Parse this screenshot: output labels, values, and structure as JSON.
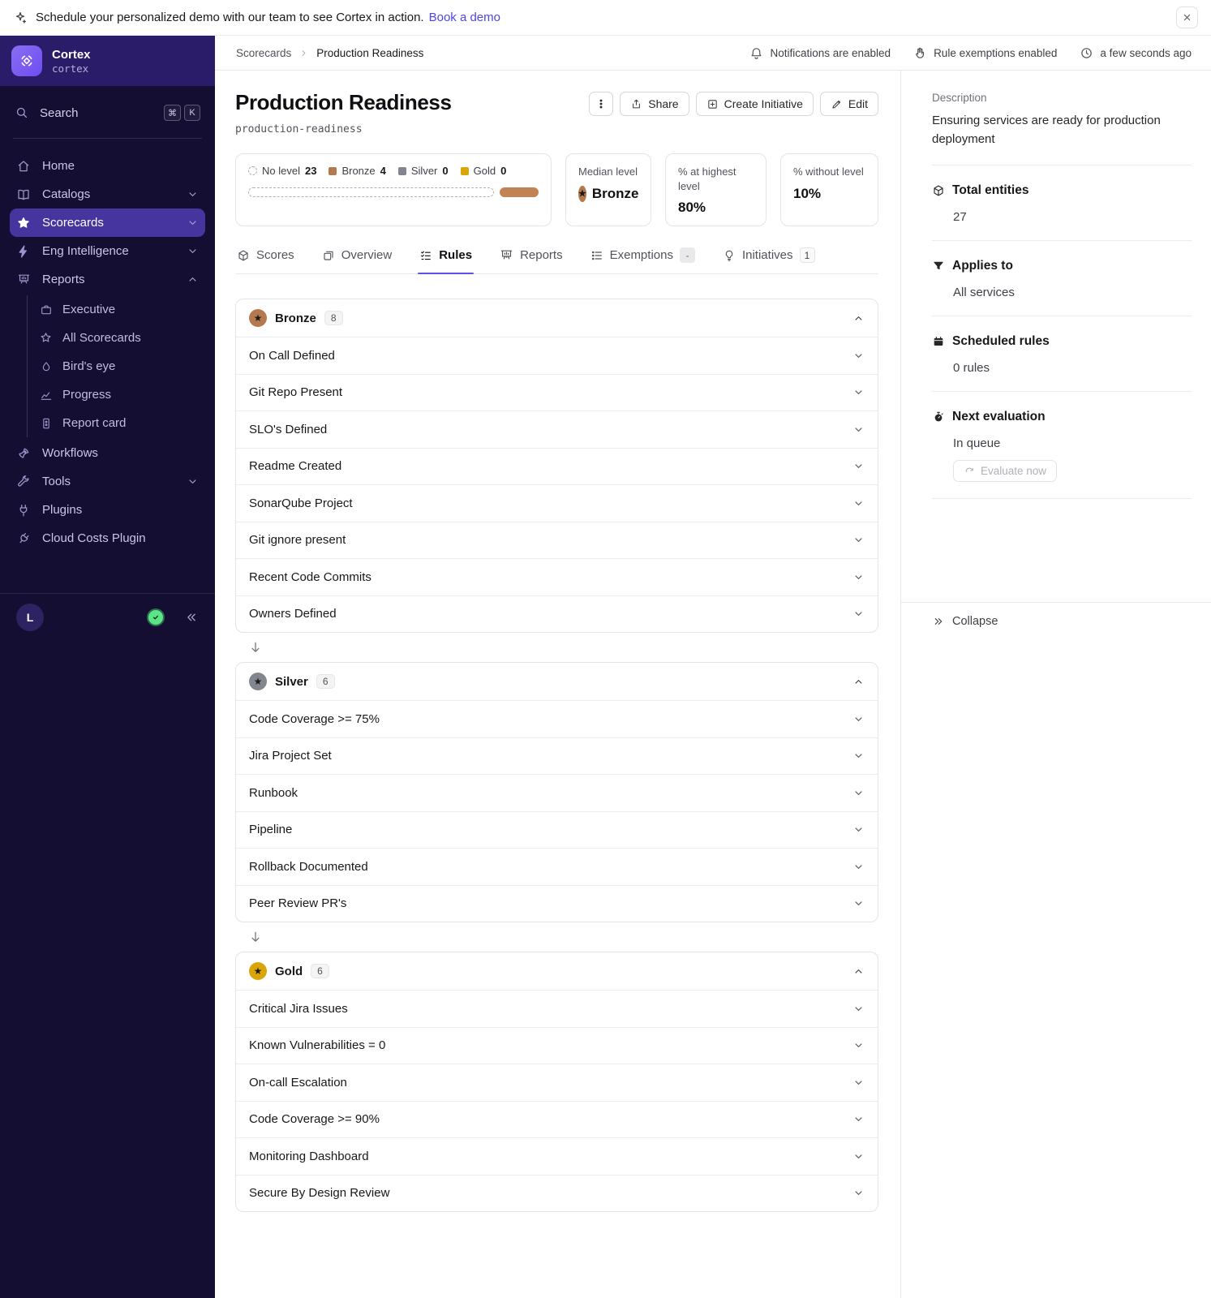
{
  "banner": {
    "text": "Schedule your personalized demo with our team to see Cortex in action.",
    "link": "Book a demo"
  },
  "sidebar": {
    "logo_title": "Cortex",
    "logo_subtitle": "cortex",
    "search": {
      "label": "Search",
      "keys": [
        "⌘",
        "K"
      ]
    },
    "items": [
      {
        "label": "Home",
        "icon": "home"
      },
      {
        "label": "Catalogs",
        "icon": "book",
        "chevron": "down"
      },
      {
        "label": "Scorecards",
        "icon": "star",
        "chevron": "down",
        "active": true
      },
      {
        "label": "Eng Intelligence",
        "icon": "lightning",
        "chevron": "down"
      },
      {
        "label": "Reports",
        "icon": "presentation",
        "chevron": "up",
        "children": [
          {
            "label": "Executive",
            "icon": "briefcase"
          },
          {
            "label": "All Scorecards",
            "icon": "star-outline"
          },
          {
            "label": "Bird's eye",
            "icon": "bird"
          },
          {
            "label": "Progress",
            "icon": "chart-line"
          },
          {
            "label": "Report card",
            "icon": "report-card"
          }
        ]
      },
      {
        "label": "Workflows",
        "icon": "rocket"
      },
      {
        "label": "Tools",
        "icon": "wrench",
        "chevron": "down"
      },
      {
        "label": "Plugins",
        "icon": "plug"
      },
      {
        "label": "Cloud Costs Plugin",
        "icon": "plug-outline"
      }
    ],
    "user_initial": "L"
  },
  "topbar": {
    "breadcrumb": [
      "Scorecards",
      "Production Readiness"
    ],
    "status": [
      {
        "label": "Notifications are enabled",
        "icon": "bell"
      },
      {
        "label": "Rule exemptions enabled",
        "icon": "hand"
      },
      {
        "label": "a few seconds ago",
        "icon": "clock"
      }
    ]
  },
  "header": {
    "title": "Production Readiness",
    "slug": "production-readiness",
    "buttons": {
      "share": "Share",
      "create_initiative": "Create Initiative",
      "edit": "Edit"
    }
  },
  "stats": {
    "levels": [
      {
        "label": "No level",
        "count": "23",
        "swatch": "dashed",
        "color": ""
      },
      {
        "label": "Bronze",
        "count": "4",
        "swatch": "solid",
        "color": "#b5794f"
      },
      {
        "label": "Silver",
        "count": "0",
        "swatch": "solid",
        "color": "#81868f"
      },
      {
        "label": "Gold",
        "count": "0",
        "swatch": "solid",
        "color": "#d9a509"
      }
    ],
    "bar": {
      "no_level_pct": 84.5,
      "bronze_pct": 13.5,
      "bronze_color": "#c18353"
    },
    "median": {
      "label": "Median level",
      "value": "Bronze",
      "medal_color": "#b5794f"
    },
    "highest": {
      "label": "% at highest level",
      "value": "80%"
    },
    "without": {
      "label": "% without level",
      "value": "10%"
    }
  },
  "tabs": [
    {
      "label": "Scores",
      "icon": "cube"
    },
    {
      "label": "Overview",
      "icon": "overview"
    },
    {
      "label": "Rules",
      "icon": "checklist",
      "active": true
    },
    {
      "label": "Reports",
      "icon": "presentation",
      "badge": ""
    },
    {
      "label": "Exemptions",
      "icon": "list",
      "badge": "-"
    },
    {
      "label": "Initiatives",
      "icon": "lightbulb",
      "badge": "1",
      "badge_style": "outlined"
    }
  ],
  "rule_groups": [
    {
      "name": "Bronze",
      "count": "8",
      "color": "#b5794f",
      "rules": [
        "On Call Defined",
        "Git Repo Present",
        "SLO's Defined",
        "Readme Created",
        "SonarQube Project",
        "Git ignore present",
        "Recent Code Commits",
        "Owners Defined"
      ]
    },
    {
      "name": "Silver",
      "count": "6",
      "color": "#81868f",
      "rules": [
        "Code Coverage >= 75%",
        "Jira Project Set",
        "Runbook",
        "Pipeline",
        "Rollback Documented",
        "Peer Review PR's"
      ]
    },
    {
      "name": "Gold",
      "count": "6",
      "color": "#d9a509",
      "rules": [
        "Critical Jira Issues",
        "Known Vulnerabilities = 0",
        "On-call Escalation",
        "Code Coverage >= 90%",
        "Monitoring Dashboard",
        "Secure By Design Review"
      ]
    }
  ],
  "details": {
    "description_label": "Description",
    "description": "Ensuring services are ready for production deployment",
    "sections": [
      {
        "icon": "cube",
        "title": "Total entities",
        "value": "27"
      },
      {
        "icon": "funnel",
        "title": "Applies to",
        "value": "All services"
      },
      {
        "icon": "calendar",
        "title": "Scheduled rules",
        "value": "0 rules"
      },
      {
        "icon": "stopwatch",
        "title": "Next evaluation",
        "value": "In queue",
        "button": "Evaluate now"
      }
    ],
    "collapse": "Collapse"
  }
}
